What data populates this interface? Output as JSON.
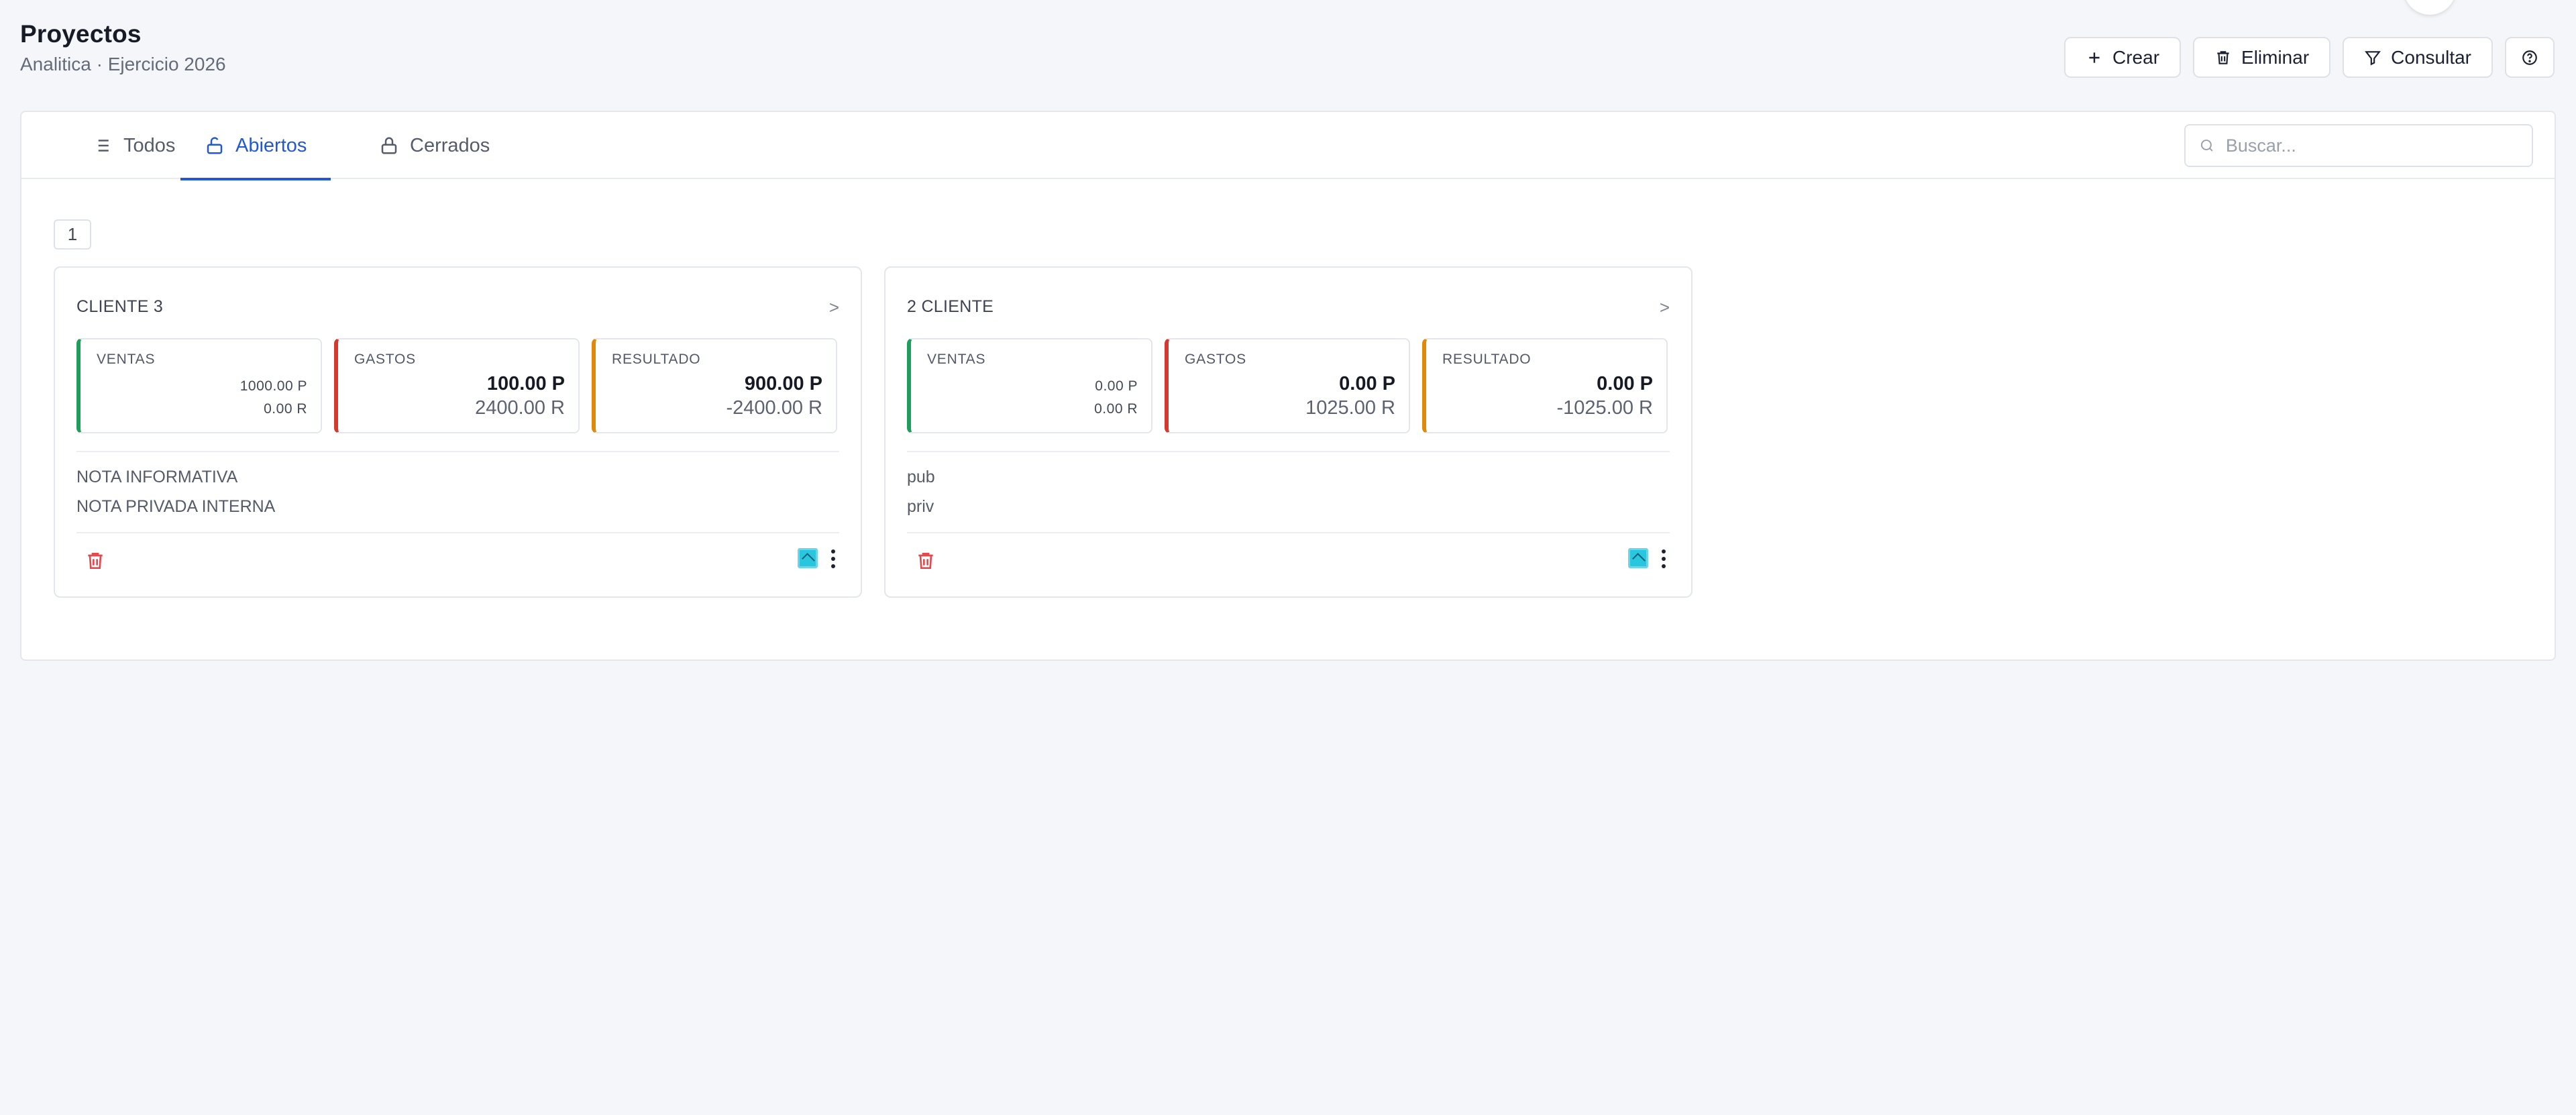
{
  "header": {
    "title": "Proyectos",
    "subtitle": "Analitica · Ejercicio 2026"
  },
  "actions": {
    "create": "Crear",
    "delete": "Eliminar",
    "query": "Consultar",
    "help_icon": "question-circle-icon"
  },
  "tabs": [
    {
      "label": "Todos",
      "icon": "list-icon"
    },
    {
      "label": "Abiertos",
      "icon": "unlock-icon",
      "active": true
    },
    {
      "label": "Cerrados",
      "icon": "lock-icon"
    }
  ],
  "search": {
    "placeholder": "Buscar..."
  },
  "pagination": {
    "current": "1"
  },
  "colors": {
    "accent": "#2457d6",
    "ventas": "#1f9d5c",
    "gastos": "#d3392f",
    "resultado": "#e08a0c",
    "trash": "#e5484d"
  },
  "cards": [
    {
      "title": "CLIENTE 3",
      "arrow": ">",
      "ventas": {
        "label": "VENTAS",
        "v1": "1000.00 P",
        "v2": "0.00 R"
      },
      "gastos": {
        "label": "GASTOS",
        "v1": "100.00 P",
        "v2": "2400.00 R"
      },
      "resultado": {
        "label": "RESULTADO",
        "v1": "900.00 P",
        "v2": "-2400.00 R"
      },
      "notes": [
        "NOTA INFORMATIVA",
        "NOTA PRIVADA INTERNA"
      ]
    },
    {
      "title": "2 CLIENTE",
      "arrow": ">",
      "ventas": {
        "label": "VENTAS",
        "v1": "0.00 P",
        "v2": "0.00 R"
      },
      "gastos": {
        "label": "GASTOS",
        "v1": "0.00 P",
        "v2": "1025.00 R"
      },
      "resultado": {
        "label": "RESULTADO",
        "v1": "0.00 P",
        "v2": "-1025.00 R"
      },
      "notes": [
        "pub",
        "priv"
      ]
    }
  ]
}
